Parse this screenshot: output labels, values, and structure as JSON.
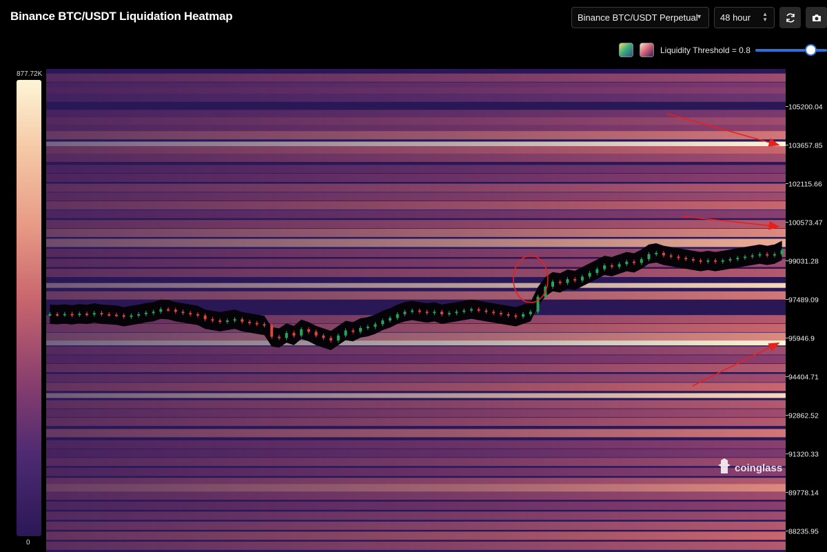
{
  "header": {
    "title": "Binance BTC/USDT Liquidation Heatmap",
    "market_select": "Binance BTC/USDT Perpetual",
    "range_select": "48 hour"
  },
  "controls": {
    "refresh_icon": "refresh-icon",
    "camera_icon": "camera-icon",
    "palette_options": [
      "green-palette",
      "magma-palette"
    ],
    "threshold_label": "Liquidity Threshold = 0.8",
    "threshold_value": 0.8
  },
  "colorscale": {
    "max_label": "877.72K",
    "min_label": "0"
  },
  "watermark": {
    "text": "coinglass"
  },
  "colors": {
    "background": "#000000",
    "up_candle": "#26a65b",
    "down_candle": "#e0473c",
    "annotation": "#e8201c",
    "accent": "#2f6fd8"
  },
  "chart_data": {
    "type": "heatmap",
    "title": "Binance BTC/USDT Liquidation Heatmap",
    "ytick_labels": [
      "105200.04",
      "103657.85",
      "102115.66",
      "100573.47",
      "99031.28",
      "97489.09",
      "95946.9",
      "94404.71",
      "92862.52",
      "91320.33",
      "89778.14",
      "88235.95"
    ],
    "ylim": [
      87400,
      106700
    ],
    "colorscale_range": [
      0,
      877720
    ],
    "liquidity_levels": [
      {
        "price": 106350,
        "intensity": 0.55
      },
      {
        "price": 106000,
        "intensity": 0.45
      },
      {
        "price": 105800,
        "intensity": 0.5
      },
      {
        "price": 105550,
        "intensity": 0.4
      },
      {
        "price": 104900,
        "intensity": 0.45
      },
      {
        "price": 104600,
        "intensity": 0.55
      },
      {
        "price": 104300,
        "intensity": 0.5
      },
      {
        "price": 104050,
        "intensity": 0.7
      },
      {
        "price": 103700,
        "intensity": 1.0
      },
      {
        "price": 103450,
        "intensity": 0.65
      },
      {
        "price": 103150,
        "intensity": 0.55
      },
      {
        "price": 102700,
        "intensity": 0.45
      },
      {
        "price": 102350,
        "intensity": 0.5
      },
      {
        "price": 101950,
        "intensity": 0.6
      },
      {
        "price": 101600,
        "intensity": 0.55
      },
      {
        "price": 101250,
        "intensity": 0.65
      },
      {
        "price": 100900,
        "intensity": 0.5
      },
      {
        "price": 100500,
        "intensity": 0.6
      },
      {
        "price": 100150,
        "intensity": 0.75
      },
      {
        "price": 99750,
        "intensity": 0.85
      },
      {
        "price": 99350,
        "intensity": 0.55
      },
      {
        "price": 98950,
        "intensity": 0.55
      },
      {
        "price": 98550,
        "intensity": 0.6
      },
      {
        "price": 98050,
        "intensity": 0.95
      },
      {
        "price": 97650,
        "intensity": 0.7
      },
      {
        "price": 96700,
        "intensity": 0.6
      },
      {
        "price": 96350,
        "intensity": 0.65
      },
      {
        "price": 96000,
        "intensity": 0.75
      },
      {
        "price": 95750,
        "intensity": 1.0
      },
      {
        "price": 95450,
        "intensity": 0.55
      },
      {
        "price": 95100,
        "intensity": 0.5
      },
      {
        "price": 94750,
        "intensity": 0.6
      },
      {
        "price": 94350,
        "intensity": 0.55
      },
      {
        "price": 94000,
        "intensity": 0.65
      },
      {
        "price": 93650,
        "intensity": 0.95
      },
      {
        "price": 93300,
        "intensity": 0.6
      },
      {
        "price": 92950,
        "intensity": 0.55
      },
      {
        "price": 92600,
        "intensity": 0.6
      },
      {
        "price": 92150,
        "intensity": 0.7
      },
      {
        "price": 91700,
        "intensity": 0.5
      },
      {
        "price": 91350,
        "intensity": 0.45
      },
      {
        "price": 91000,
        "intensity": 0.55
      },
      {
        "price": 90600,
        "intensity": 0.5
      },
      {
        "price": 90200,
        "intensity": 0.6
      },
      {
        "price": 89950,
        "intensity": 0.75
      },
      {
        "price": 89650,
        "intensity": 0.55
      },
      {
        "price": 89250,
        "intensity": 0.5
      },
      {
        "price": 88850,
        "intensity": 0.55
      },
      {
        "price": 88450,
        "intensity": 0.6
      },
      {
        "price": 88050,
        "intensity": 0.65
      },
      {
        "price": 87650,
        "intensity": 0.6
      }
    ],
    "price_series": [
      96900,
      96880,
      96910,
      96870,
      96920,
      96890,
      96950,
      96900,
      96880,
      96860,
      96800,
      96850,
      96900,
      96960,
      97000,
      97100,
      97080,
      97000,
      96950,
      96900,
      96850,
      96700,
      96650,
      96600,
      96650,
      96700,
      96600,
      96550,
      96500,
      96450,
      96000,
      95950,
      96150,
      96050,
      96300,
      96200,
      96050,
      95950,
      95850,
      96050,
      96250,
      96200,
      96350,
      96400,
      96500,
      96650,
      96750,
      96900,
      97000,
      97050,
      97000,
      96950,
      97000,
      96900,
      96950,
      97000,
      97050,
      97100,
      97050,
      97000,
      96950,
      96900,
      96850,
      96800,
      96900,
      97000,
      97600,
      98000,
      98200,
      98150,
      98300,
      98250,
      98400,
      98550,
      98700,
      98850,
      98800,
      98900,
      99000,
      98950,
      99100,
      99300,
      99350,
      99250,
      99200,
      99150,
      99100,
      99050,
      99000,
      99050,
      99000,
      99050,
      99100,
      99150,
      99200,
      99250,
      99300,
      99250,
      99300,
      99450
    ],
    "annotations": [
      {
        "type": "arrow",
        "target_price": 103657.85,
        "label": ""
      },
      {
        "type": "arrow",
        "target_price": 100400,
        "label": ""
      },
      {
        "type": "arrow",
        "target_price": 95750,
        "label": ""
      },
      {
        "type": "circle",
        "price": 98300,
        "label": ""
      }
    ]
  }
}
